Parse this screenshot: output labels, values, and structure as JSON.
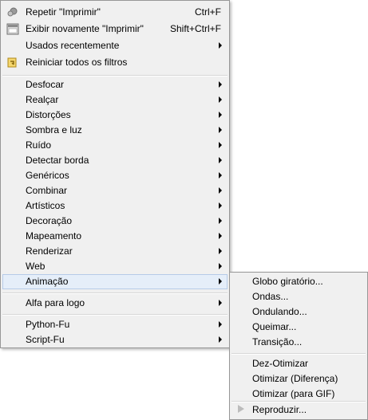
{
  "main_menu": {
    "repeat": {
      "label": "Repetir \"Imprimir\"",
      "shortcut": "Ctrl+F",
      "icon": "repeat-icon"
    },
    "reshow": {
      "label": "Exibir novamente \"Imprimir\"",
      "shortcut": "Shift+Ctrl+F",
      "icon": "reshow-icon"
    },
    "recent": {
      "label": "Usados recentemente"
    },
    "reset": {
      "label": "Reiniciar todos os filtros",
      "icon": "reset-icon"
    },
    "categories": [
      {
        "label": "Desfocar"
      },
      {
        "label": "Realçar"
      },
      {
        "label": "Distorções"
      },
      {
        "label": "Sombra e luz"
      },
      {
        "label": "Ruído"
      },
      {
        "label": "Detectar borda"
      },
      {
        "label": "Genéricos"
      },
      {
        "label": "Combinar"
      },
      {
        "label": "Artísticos"
      },
      {
        "label": "Decoração"
      },
      {
        "label": "Mapeamento"
      },
      {
        "label": "Renderizar"
      },
      {
        "label": "Web"
      },
      {
        "label": "Animação"
      }
    ],
    "alpha_to_logo": {
      "label": "Alfa para logo"
    },
    "scripts": [
      {
        "label": "Python-Fu"
      },
      {
        "label": "Script-Fu"
      }
    ]
  },
  "submenu_animacao": {
    "group1": [
      {
        "label": "Globo giratório..."
      },
      {
        "label": "Ondas..."
      },
      {
        "label": "Ondulando..."
      },
      {
        "label": "Queimar..."
      },
      {
        "label": "Transição..."
      }
    ],
    "group2": [
      {
        "label": "Dez-Otimizar"
      },
      {
        "label": "Otimizar (Diferença)"
      },
      {
        "label": "Otimizar (para GIF)"
      }
    ],
    "playback": {
      "label": "Reproduzir...",
      "icon": "play-icon"
    }
  },
  "colors": {
    "highlight_bg": "#e5eef9",
    "highlight_border": "#b6cbe8",
    "menu_bg": "#f0f0f0"
  }
}
